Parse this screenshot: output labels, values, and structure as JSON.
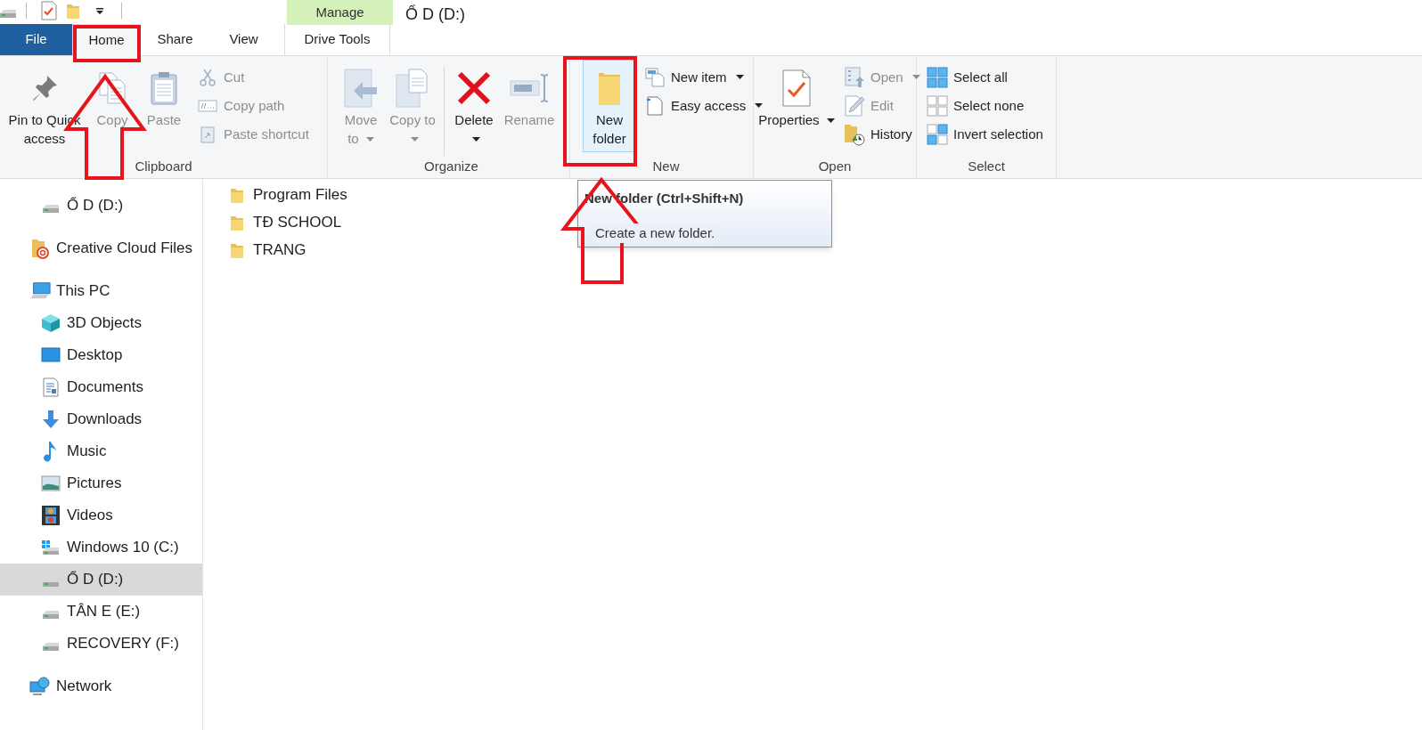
{
  "contextual_tab": {
    "label": "Manage"
  },
  "window": {
    "title": "Ổ D (D:)"
  },
  "tabs": [
    {
      "label": "File",
      "kind": "file",
      "selected": false
    },
    {
      "label": "Home",
      "kind": "plain",
      "selected": true
    },
    {
      "label": "Share",
      "kind": "plain",
      "selected": false
    },
    {
      "label": "View",
      "kind": "plain",
      "selected": false
    },
    {
      "label": "Drive Tools",
      "kind": "contextual",
      "selected": false
    }
  ],
  "ribbon": {
    "groups": [
      {
        "label": "Clipboard",
        "commands": [
          {
            "label": "Pin to Quick access",
            "kind": "large",
            "disabled": false,
            "menu": false,
            "hovered": false
          },
          {
            "label": "Copy",
            "kind": "large",
            "disabled": true,
            "menu": false,
            "hovered": false
          },
          {
            "label": "Paste",
            "kind": "large",
            "disabled": true,
            "menu": false,
            "hovered": false
          },
          {
            "label": "Cut",
            "kind": "small",
            "disabled": true,
            "menu": false,
            "hovered": false
          },
          {
            "label": "Copy path",
            "kind": "small",
            "disabled": true,
            "menu": false,
            "hovered": false
          },
          {
            "label": "Paste shortcut",
            "kind": "small",
            "disabled": true,
            "menu": false,
            "hovered": false
          }
        ]
      },
      {
        "label": "Organize",
        "commands": [
          {
            "label": "Move to",
            "kind": "large",
            "disabled": true,
            "menu": true,
            "hovered": false
          },
          {
            "label": "Copy to",
            "kind": "large",
            "disabled": true,
            "menu": true,
            "hovered": false
          },
          {
            "label": "Delete",
            "kind": "large",
            "disabled": false,
            "menu": true,
            "hovered": false
          },
          {
            "label": "Rename",
            "kind": "large",
            "disabled": true,
            "menu": false,
            "hovered": false
          }
        ]
      },
      {
        "label": "New",
        "commands": [
          {
            "label": "New folder",
            "kind": "large",
            "disabled": false,
            "menu": false,
            "hovered": true
          },
          {
            "label": "New item",
            "kind": "small",
            "disabled": false,
            "menu": true,
            "hovered": false
          },
          {
            "label": "Easy access",
            "kind": "small",
            "disabled": false,
            "menu": true,
            "hovered": false
          }
        ]
      },
      {
        "label": "Open",
        "commands": [
          {
            "label": "Properties",
            "kind": "large",
            "disabled": false,
            "menu": true,
            "hovered": false
          },
          {
            "label": "Open",
            "kind": "small",
            "disabled": true,
            "menu": true,
            "hovered": false
          },
          {
            "label": "Edit",
            "kind": "small",
            "disabled": true,
            "menu": false,
            "hovered": false
          },
          {
            "label": "History",
            "kind": "small",
            "disabled": false,
            "menu": false,
            "hovered": false
          }
        ]
      },
      {
        "label": "Select",
        "commands": [
          {
            "label": "Select all",
            "kind": "small",
            "disabled": false,
            "menu": false,
            "hovered": false
          },
          {
            "label": "Select none",
            "kind": "small",
            "disabled": false,
            "menu": false,
            "hovered": false
          },
          {
            "label": "Invert selection",
            "kind": "small",
            "disabled": false,
            "menu": false,
            "hovered": false
          }
        ]
      }
    ]
  },
  "navigation": [
    {
      "children": [
        {
          "label": "Ổ D (D:)",
          "kind": "drive",
          "selected": false
        }
      ]
    },
    {
      "label": "Creative Cloud Files",
      "kind": "cloud",
      "selected": false
    },
    {
      "label": "This PC",
      "kind": "computer",
      "selected": false,
      "children": [
        {
          "label": "3D Objects",
          "kind": "cube",
          "selected": false
        },
        {
          "label": "Desktop",
          "kind": "desktop",
          "selected": false
        },
        {
          "label": "Documents",
          "kind": "documents",
          "selected": false
        },
        {
          "label": "Downloads",
          "kind": "downloads",
          "selected": false
        },
        {
          "label": "Music",
          "kind": "music",
          "selected": false
        },
        {
          "label": "Pictures",
          "kind": "pictures",
          "selected": false
        },
        {
          "label": "Videos",
          "kind": "videos",
          "selected": false
        },
        {
          "label": "Windows 10 (C:)",
          "kind": "system",
          "selected": false
        },
        {
          "label": "Ổ D (D:)",
          "kind": "drive",
          "selected": true
        },
        {
          "label": "TÂN E (E:)",
          "kind": "drive",
          "selected": false
        },
        {
          "label": "RECOVERY (F:)",
          "kind": "drive",
          "selected": false
        }
      ]
    },
    {
      "label": "Network",
      "kind": "network",
      "selected": false
    }
  ],
  "files": [
    {
      "name": "Program Files"
    },
    {
      "name": "TĐ SCHOOL"
    },
    {
      "name": "TRANG"
    }
  ],
  "tooltip": {
    "title": "New folder (Ctrl+Shift+N)",
    "description": "Create a new folder."
  }
}
